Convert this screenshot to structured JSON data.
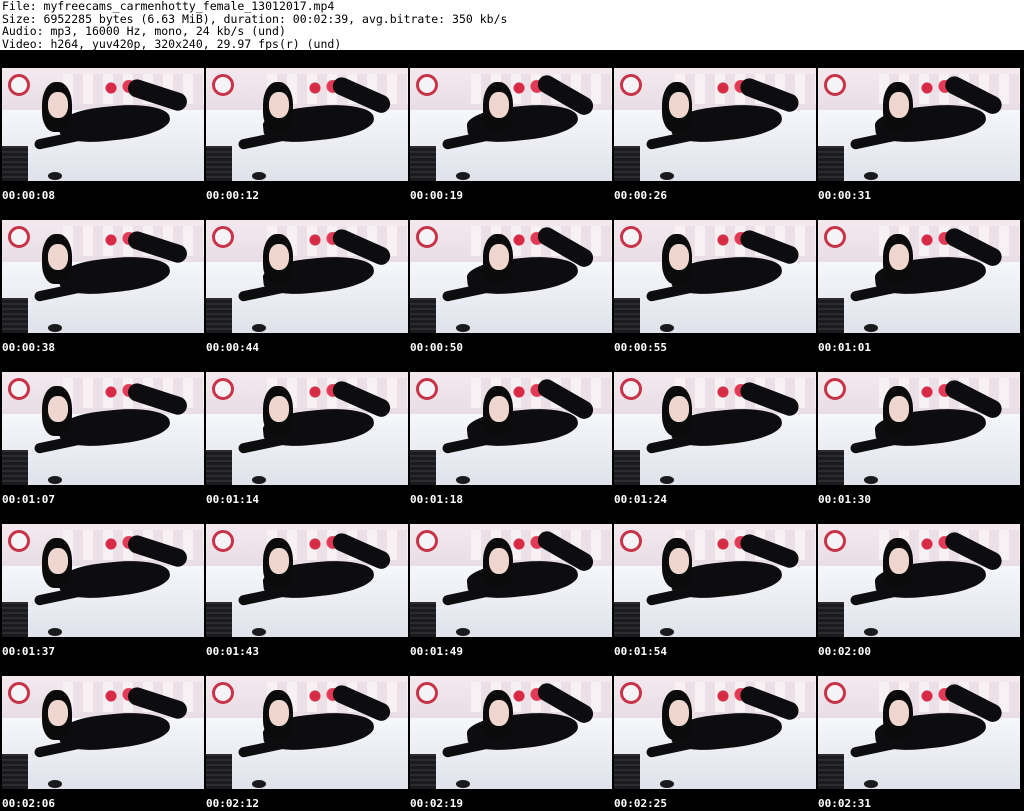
{
  "header": {
    "file": "File: myfreecams_carmenhotty_female_13012017.mp4",
    "size": "Size: 6952285 bytes (6.63 MiB), duration: 00:02:39, avg.bitrate: 350 kb/s",
    "audio": "Audio: mp3, 16000 Hz, mono, 24 kb/s (und)",
    "video": "Video: h264, yuv420p, 320x240, 29.97 fps(r) (und)"
  },
  "thumbnails": [
    {
      "timestamp": "00:00:08"
    },
    {
      "timestamp": "00:00:12"
    },
    {
      "timestamp": "00:00:19"
    },
    {
      "timestamp": "00:00:26"
    },
    {
      "timestamp": "00:00:31"
    },
    {
      "timestamp": "00:00:38"
    },
    {
      "timestamp": "00:00:44"
    },
    {
      "timestamp": "00:00:50"
    },
    {
      "timestamp": "00:00:55"
    },
    {
      "timestamp": "00:01:01"
    },
    {
      "timestamp": "00:01:07"
    },
    {
      "timestamp": "00:01:14"
    },
    {
      "timestamp": "00:01:18"
    },
    {
      "timestamp": "00:01:24"
    },
    {
      "timestamp": "00:01:30"
    },
    {
      "timestamp": "00:01:37"
    },
    {
      "timestamp": "00:01:43"
    },
    {
      "timestamp": "00:01:49"
    },
    {
      "timestamp": "00:01:54"
    },
    {
      "timestamp": "00:02:00"
    },
    {
      "timestamp": "00:02:06"
    },
    {
      "timestamp": "00:02:12"
    },
    {
      "timestamp": "00:02:19"
    },
    {
      "timestamp": "00:02:25"
    },
    {
      "timestamp": "00:02:31"
    }
  ],
  "colors": {
    "background": "#ffffff",
    "grid_background": "#000000",
    "timestamp_text": "#ffffff"
  }
}
